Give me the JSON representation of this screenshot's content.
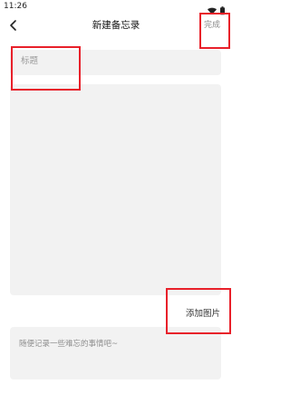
{
  "status_bar": {
    "time": "11:26",
    "icons": [
      "wifi-icon",
      "battery-icon"
    ]
  },
  "header": {
    "back_icon": "chevron-left-icon",
    "title": "新建备忘录",
    "done_label": "完成"
  },
  "form": {
    "title_placeholder": "标题",
    "content_placeholder": "",
    "add_image_label": "添加图片",
    "note_placeholder": "随便记录一些难忘的事情吧~"
  },
  "colors": {
    "field_background": "#f2f2f2",
    "highlight": "#e8202a",
    "placeholder_text": "#9a9a9a"
  }
}
